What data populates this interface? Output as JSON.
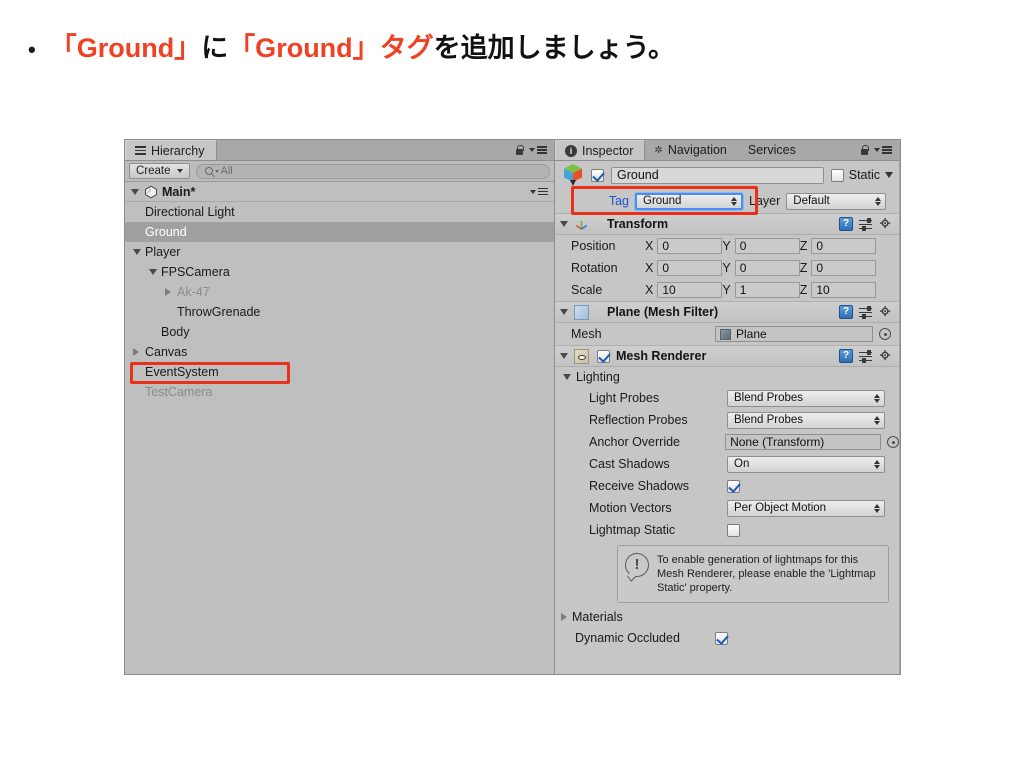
{
  "slide": {
    "bullet_marker": "•",
    "title_parts": [
      {
        "text": "「Ground」",
        "color": "red"
      },
      {
        "text": "に",
        "color": "black"
      },
      {
        "text": "「Ground」タグ",
        "color": "red"
      },
      {
        "text": "を追加しましょう。",
        "color": "black"
      }
    ],
    "accent_red": "#f04124",
    "annotation_red": "#e8301a"
  },
  "hierarchy": {
    "tab_label": "Hierarchy",
    "toolbar": {
      "create_label": "Create",
      "search_placeholder": "All",
      "search_value": ""
    },
    "scene_name": "Main*",
    "items": [
      {
        "label": "Directional Light",
        "depth": 1,
        "arrow": "none",
        "state": "normal",
        "selected": false
      },
      {
        "label": "Ground",
        "depth": 1,
        "arrow": "none",
        "state": "normal",
        "selected": true
      },
      {
        "label": "Player",
        "depth": 1,
        "arrow": "down",
        "state": "normal",
        "selected": false
      },
      {
        "label": "FPSCamera",
        "depth": 2,
        "arrow": "down",
        "state": "normal",
        "selected": false
      },
      {
        "label": "Ak-47",
        "depth": 3,
        "arrow": "right",
        "state": "disabled",
        "selected": false
      },
      {
        "label": "ThrowGrenade",
        "depth": 3,
        "arrow": "none",
        "state": "normal",
        "selected": false
      },
      {
        "label": "Body",
        "depth": 2,
        "arrow": "none",
        "state": "normal",
        "selected": false
      },
      {
        "label": "Canvas",
        "depth": 1,
        "arrow": "right",
        "state": "normal",
        "selected": false
      },
      {
        "label": "EventSystem",
        "depth": 1,
        "arrow": "none",
        "state": "normal",
        "selected": false
      },
      {
        "label": "TestCamera",
        "depth": 1,
        "arrow": "none",
        "state": "disabled",
        "selected": false
      }
    ]
  },
  "inspector": {
    "tabs": [
      {
        "label": "Inspector",
        "active": true,
        "icon": "info-icon"
      },
      {
        "label": "Navigation",
        "active": false,
        "icon": "navigation-icon"
      },
      {
        "label": "Services",
        "active": false,
        "icon": "none"
      }
    ],
    "object": {
      "enabled": true,
      "name": "Ground",
      "static_label": "Static",
      "static_checked": false,
      "tag_label": "Tag",
      "tag_value": "Ground",
      "layer_label": "Layer",
      "layer_value": "Default"
    },
    "transform": {
      "title": "Transform",
      "expanded": true,
      "rows": [
        {
          "label": "Position",
          "x": "0",
          "y": "0",
          "z": "0"
        },
        {
          "label": "Rotation",
          "x": "0",
          "y": "0",
          "z": "0"
        },
        {
          "label": "Scale",
          "x": "10",
          "y": "1",
          "z": "10"
        }
      ],
      "axes": {
        "x": "X",
        "y": "Y",
        "z": "Z"
      }
    },
    "mesh_filter": {
      "title": "Plane (Mesh Filter)",
      "expanded": true,
      "mesh_label": "Mesh",
      "mesh_value": "Plane"
    },
    "mesh_renderer": {
      "title": "Mesh Renderer",
      "expanded": true,
      "enabled": true,
      "lighting_label": "Lighting",
      "properties": [
        {
          "label": "Light Probes",
          "type": "popup",
          "value": "Blend Probes"
        },
        {
          "label": "Reflection Probes",
          "type": "popup",
          "value": "Blend Probes"
        },
        {
          "label": "Anchor Override",
          "type": "objfield",
          "value": "None (Transform)"
        },
        {
          "label": "Cast Shadows",
          "type": "popup",
          "value": "On"
        },
        {
          "label": "Receive Shadows",
          "type": "checkbox",
          "value": true
        },
        {
          "label": "Motion Vectors",
          "type": "popup",
          "value": "Per Object Motion"
        },
        {
          "label": "Lightmap Static",
          "type": "checkbox",
          "value": false
        }
      ],
      "help_text": "To enable generation of lightmaps for this Mesh Renderer, please enable the 'Lightmap Static' property.",
      "materials_label": "Materials",
      "dynamic_occluded_label": "Dynamic Occluded",
      "dynamic_occluded_checked": true
    },
    "component_icons": {
      "help": "?",
      "preset": "preset-icon",
      "gear": "gear-icon"
    }
  }
}
